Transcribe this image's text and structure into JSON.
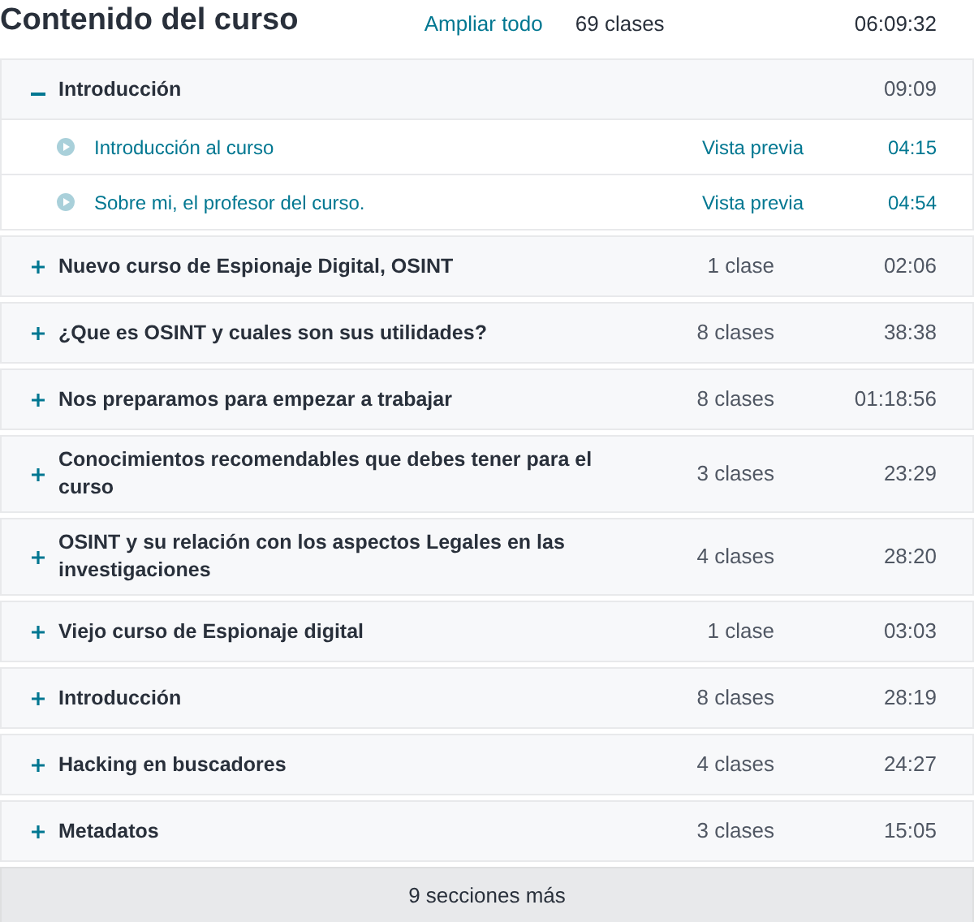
{
  "header": {
    "title": "Contenido del curso",
    "expand_all": "Ampliar todo",
    "total_lectures": "69 clases",
    "total_duration": "06:09:32"
  },
  "sections": [
    {
      "title": "Introducción",
      "expanded": true,
      "duration": "09:09",
      "lectures": [
        {
          "title": "Introducción al curso",
          "preview": "Vista previa",
          "duration": "04:15"
        },
        {
          "title": "Sobre mi, el profesor del curso.",
          "preview": "Vista previa",
          "duration": "04:54"
        }
      ]
    },
    {
      "title": "Nuevo curso de Espionaje Digital, OSINT",
      "expanded": false,
      "count": "1 clase",
      "duration": "02:06"
    },
    {
      "title": "¿Que es OSINT y cuales son sus utilidades?",
      "expanded": false,
      "count": "8 clases",
      "duration": "38:38"
    },
    {
      "title": "Nos preparamos para empezar a trabajar",
      "expanded": false,
      "count": "8 clases",
      "duration": "01:18:56"
    },
    {
      "title": "Conocimientos recomendables que debes tener para el curso",
      "expanded": false,
      "count": "3 clases",
      "duration": "23:29"
    },
    {
      "title": "OSINT y su relación con los aspectos Legales en las investigaciones",
      "expanded": false,
      "count": "4 clases",
      "duration": "28:20"
    },
    {
      "title": "Viejo curso de Espionaje digital",
      "expanded": false,
      "count": "1 clase",
      "duration": "03:03"
    },
    {
      "title": "Introducción",
      "expanded": false,
      "count": "8 clases",
      "duration": "28:19"
    },
    {
      "title": "Hacking en buscadores",
      "expanded": false,
      "count": "4 clases",
      "duration": "24:27"
    },
    {
      "title": "Metadatos",
      "expanded": false,
      "count": "3 clases",
      "duration": "15:05"
    }
  ],
  "more_sections": "9 secciones más"
}
